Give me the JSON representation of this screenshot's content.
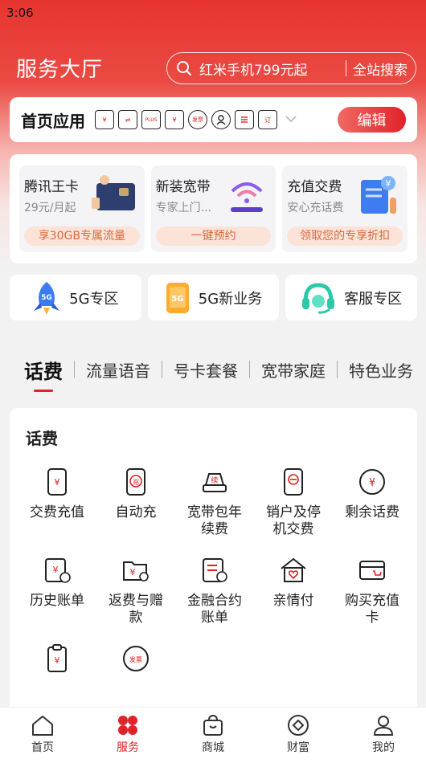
{
  "status": {
    "time": "3:06"
  },
  "header": {
    "title": "服务大厅",
    "search_placeholder": "红米手机799元起",
    "search_button": "全站搜索"
  },
  "home_apps": {
    "label": "首页应用",
    "edit_label": "编辑",
    "icons": [
      "phone-yuan-icon",
      "transfer-card-icon",
      "vip-crown-icon",
      "bill-yuan-icon",
      "invoice-icon",
      "user-circle-icon",
      "document-icon",
      "order-icon"
    ],
    "mini_texts": [
      "¥",
      "⇌",
      "PLUS",
      "¥",
      "发票",
      "",
      "",
      "订"
    ]
  },
  "promos": [
    {
      "title": "腾讯王卡",
      "subtitle": "29元/月起",
      "action": "享30GB专属流量"
    },
    {
      "title": "新装宽带",
      "subtitle": "专家上门...",
      "action": "一键预约"
    },
    {
      "title": "充值交费",
      "subtitle": "安心充话费",
      "action": "领取您的专享折扣"
    }
  ],
  "zones": [
    {
      "label": "5G专区",
      "icon": "rocket-5g-icon",
      "badge": "5G"
    },
    {
      "label": "5G新业务",
      "icon": "phone-5g-icon",
      "badge": "5G"
    },
    {
      "label": "客服专区",
      "icon": "headset-icon"
    }
  ],
  "tabs": [
    "话费",
    "流量语音",
    "号卡套餐",
    "宽带家庭",
    "特色业务"
  ],
  "section": {
    "title": "话费",
    "items": [
      {
        "label": "交费充值",
        "icon": "phone-yuan-icon",
        "glyph": "¥"
      },
      {
        "label": "自动充",
        "icon": "auto-recharge-icon",
        "glyph": "充"
      },
      {
        "label": "宽带包年续费",
        "icon": "router-renew-icon",
        "glyph": "续"
      },
      {
        "label": "销户及停机交费",
        "icon": "phone-stop-icon"
      },
      {
        "label": "剩余话费",
        "icon": "yuan-circle-icon",
        "glyph": "¥"
      },
      {
        "label": "历史账单",
        "icon": "bill-history-icon",
        "glyph": "¥"
      },
      {
        "label": "返费与赠款",
        "icon": "wallet-refund-icon",
        "glyph": "¥"
      },
      {
        "label": "金融合约账单",
        "icon": "finance-bill-icon"
      },
      {
        "label": "亲情付",
        "icon": "family-pay-icon"
      },
      {
        "label": "购买充值卡",
        "icon": "buy-card-icon"
      },
      {
        "label": "",
        "icon": "clipboard-yuan-icon",
        "glyph": "¥"
      },
      {
        "label": "",
        "icon": "invoice-icon",
        "glyph": "发票"
      }
    ]
  },
  "tabbar": [
    {
      "label": "首页",
      "icon": "home-icon"
    },
    {
      "label": "服务",
      "icon": "service-icon",
      "active": true
    },
    {
      "label": "商城",
      "icon": "shopping-bag-icon"
    },
    {
      "label": "财富",
      "icon": "wealth-icon"
    },
    {
      "label": "我的",
      "icon": "profile-icon"
    }
  ],
  "colors": {
    "accent": "#e0222a",
    "hero_top": "#e8342f",
    "promo_pill_text": "#d96a3f"
  }
}
